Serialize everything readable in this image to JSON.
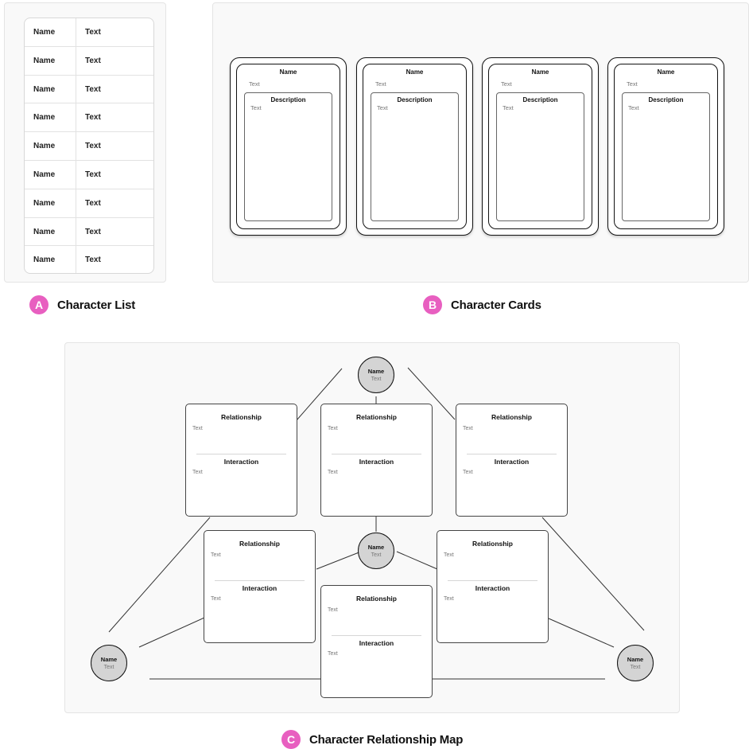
{
  "character_list": {
    "rows": [
      {
        "name": "Name",
        "text": "Text"
      },
      {
        "name": "Name",
        "text": "Text"
      },
      {
        "name": "Name",
        "text": "Text"
      },
      {
        "name": "Name",
        "text": "Text"
      },
      {
        "name": "Name",
        "text": "Text"
      },
      {
        "name": "Name",
        "text": "Text"
      },
      {
        "name": "Name",
        "text": "Text"
      },
      {
        "name": "Name",
        "text": "Text"
      },
      {
        "name": "Name",
        "text": "Text"
      }
    ]
  },
  "character_cards": {
    "cards": [
      {
        "name": "Name",
        "text": "Text",
        "description_title": "Description",
        "description_text": "Text"
      },
      {
        "name": "Name",
        "text": "Text",
        "description_title": "Description",
        "description_text": "Text"
      },
      {
        "name": "Name",
        "text": "Text",
        "description_title": "Description",
        "description_text": "Text"
      },
      {
        "name": "Name",
        "text": "Text",
        "description_title": "Description",
        "description_text": "Text"
      }
    ]
  },
  "relationship_map": {
    "nodes": [
      {
        "name": "Name",
        "text": "Text"
      },
      {
        "name": "Name",
        "text": "Text"
      },
      {
        "name": "Name",
        "text": "Text"
      },
      {
        "name": "Name",
        "text": "Text"
      }
    ],
    "boxes": [
      {
        "relationship_title": "Relationship",
        "relationship_text": "Text",
        "interaction_title": "Interaction",
        "interaction_text": "Text"
      },
      {
        "relationship_title": "Relationship",
        "relationship_text": "Text",
        "interaction_title": "Interaction",
        "interaction_text": "Text"
      },
      {
        "relationship_title": "Relationship",
        "relationship_text": "Text",
        "interaction_title": "Interaction",
        "interaction_text": "Text"
      },
      {
        "relationship_title": "Relationship",
        "relationship_text": "Text",
        "interaction_title": "Interaction",
        "interaction_text": "Text"
      },
      {
        "relationship_title": "Relationship",
        "relationship_text": "Text",
        "interaction_title": "Interaction",
        "interaction_text": "Text"
      },
      {
        "relationship_title": "Relationship",
        "relationship_text": "Text",
        "interaction_title": "Interaction",
        "interaction_text": "Text"
      }
    ]
  },
  "captions": [
    {
      "letter": "A",
      "label": "Character List"
    },
    {
      "letter": "B",
      "label": "Character Cards"
    },
    {
      "letter": "C",
      "label": "Character Relationship Map"
    }
  ],
  "colors": {
    "badge": "#e85fc0",
    "panel_background": "#f9f9f9",
    "node_fill": "#d4d4d4"
  }
}
